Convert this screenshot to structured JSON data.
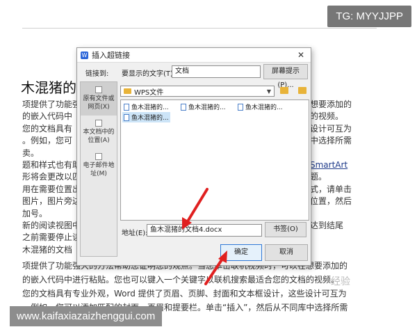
{
  "overlay": {
    "tg_badge": "TG: MYYJJPP",
    "site_url": "www.kaifaxiazaizhenggui.com"
  },
  "document": {
    "heading": "木混猪的",
    "left_lines": [
      "项提供了功能强",
      "的嵌入代码中",
      "您的文档具有",
      "。例如，您可",
      "卖。",
      "题和样式也有助",
      "形将会更改以匹",
      "用在需要位置出",
      "图片，图片旁边",
      "加号。",
      "新的阅读视图中",
      "之前需要停止读",
      "木混猪的文档"
    ],
    "right_lines": [
      "想要添加的",
      "的视频。",
      "设计可互为",
      "中选择所需",
      "",
      "SmartArt",
      "题。",
      "式，请单击",
      "位置，然后",
      "",
      "达到结尾",
      "",
      ""
    ],
    "bottom_lines": [
      "项提供了功能强大的方法帮助您证明您的观点。当您单击联机视频时，可以在想要添加的",
      "的嵌入代码中进行粘贴。您也可以键入一个关键字以联机搜索最适合您的文档的视频。",
      "您的文档具有专业外观，Word 提供了页眉、页脚、封面和文本框设计，这些设计可互为",
      "。例如，您可以添加匹配的封面、页眉和提要栏。单击“插入”，然后从不同库中选择所需"
    ],
    "watermark": "经验"
  },
  "dialog": {
    "title": "插入超链接",
    "link_to_label": "链接到:",
    "display_text_label": "要显示的文字(T):",
    "display_text_value": "文档",
    "screen_tip_button": "屏幕提示(P)...",
    "sidebar": [
      {
        "label": "原有文件或网页(X)",
        "active": true
      },
      {
        "label": "本文档中的位置(A)",
        "active": false
      },
      {
        "label": "电子邮件地址(M)",
        "active": false
      }
    ],
    "folder": "WPS文件",
    "files": [
      {
        "name": "鱼木混猪的...",
        "selected": false
      },
      {
        "name": "鱼木混猪的...",
        "selected": false
      },
      {
        "name": "鱼木混猪的...",
        "selected": false
      },
      {
        "name": "鱼木混猪的...",
        "selected": true
      }
    ],
    "address_label": "地址(E):",
    "address_value": "鱼木混猪的文档4.docx",
    "bookmark_button": "书签(O)",
    "ok_button": "确定",
    "cancel_button": "取消"
  },
  "colors": {
    "arrow": "#e02020",
    "accent": "#2b65d9"
  }
}
